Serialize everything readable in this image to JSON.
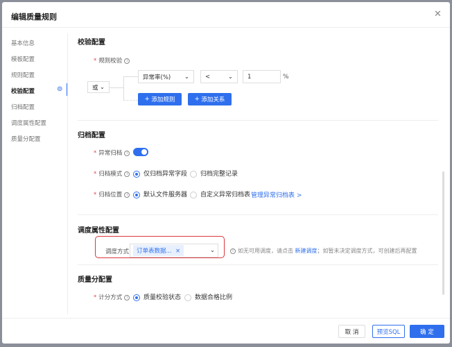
{
  "dialog": {
    "title": "编辑质量规则",
    "close_icon": "close-icon"
  },
  "sidebar": {
    "items": [
      {
        "label": "基本信息"
      },
      {
        "label": "模板配置"
      },
      {
        "label": "规则配置"
      },
      {
        "label": "校验配置",
        "active": true
      },
      {
        "label": "归档配置"
      },
      {
        "label": "调度属性配置"
      },
      {
        "label": "质量分配置"
      }
    ]
  },
  "validation": {
    "title": "校验配置",
    "rule_label": "规则校验",
    "logic": "或",
    "metric": "异常率(%)",
    "operator": "<",
    "value": "1",
    "unit": "%",
    "add_rule": "添加规则",
    "add_relation": "添加关系"
  },
  "archive": {
    "title": "归档配置",
    "switch_label": "异常归档",
    "switch_on": true,
    "mode_label": "归档模式",
    "mode_options": [
      "仅归档异常字段",
      "归档完整记录"
    ],
    "mode_selected": 0,
    "location_label": "归档位置",
    "location_options": [
      "默认文件服务器",
      "自定义异常归档表"
    ],
    "location_selected": 0,
    "manage_link": "管理异常归档表 >"
  },
  "schedule": {
    "title": "调度属性配置",
    "label": "调度方式",
    "tag": "订单表数据...",
    "hint_prefix": "如无可用调度，请点击",
    "hint_link": "新建调度",
    "hint_suffix": "；如暂未决定调度方式，可创建后再配置",
    "highlight_color": "#d9363e"
  },
  "score": {
    "title": "质量分配置",
    "label": "计分方式",
    "options": [
      "质量校验状态",
      "数据合格比例"
    ],
    "selected": 0
  },
  "footer": {
    "cancel": "取 消",
    "preview": "预览SQL",
    "ok": "确 定"
  },
  "colors": {
    "primary": "#2f6fed"
  }
}
